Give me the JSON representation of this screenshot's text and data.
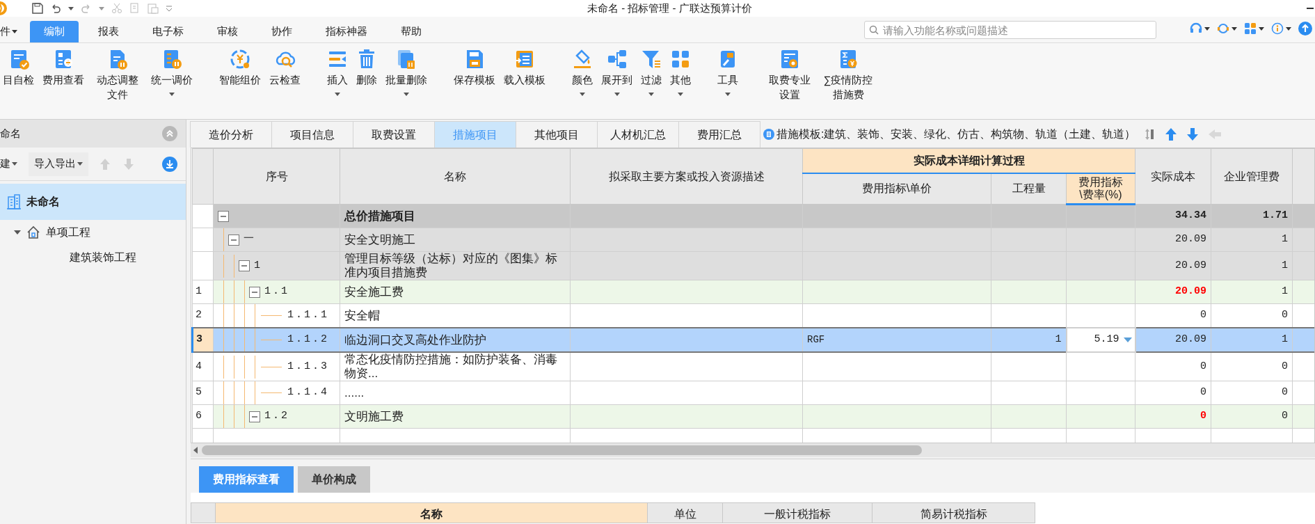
{
  "title_bar": {
    "title": "未命名 - 招标管理 - 广联达预算计价"
  },
  "menu": [
    {
      "label": "件",
      "selected": false
    },
    {
      "label": "编制",
      "selected": true
    },
    {
      "label": "报表",
      "selected": false
    },
    {
      "label": "电子标",
      "selected": false
    },
    {
      "label": "审核",
      "selected": false
    },
    {
      "label": "协作",
      "selected": false
    },
    {
      "label": "指标神器",
      "selected": false
    },
    {
      "label": "帮助",
      "selected": false
    }
  ],
  "search": {
    "placeholder": "请输入功能名称或问题描述"
  },
  "ribbon": {
    "groups": [
      [
        {
          "label": "目自检",
          "dropdown": false
        },
        {
          "label": "费用查看",
          "dropdown": false
        },
        {
          "label": "动态调整文件",
          "dropdown": false
        },
        {
          "label": "统一调价",
          "dropdown": true
        }
      ],
      [
        {
          "label": "智能组价",
          "dropdown": false
        },
        {
          "label": "云检查",
          "dropdown": false
        }
      ],
      [
        {
          "label": "插入",
          "dropdown": true
        },
        {
          "label": "删除",
          "dropdown": false
        },
        {
          "label": "批量删除",
          "dropdown": true
        }
      ],
      [
        {
          "label": "保存模板",
          "dropdown": false
        },
        {
          "label": "载入模板",
          "dropdown": false
        }
      ],
      [
        {
          "label": "颜色",
          "dropdown": true
        },
        {
          "label": "展开到",
          "dropdown": true
        },
        {
          "label": "过滤",
          "dropdown": true
        },
        {
          "label": "其他",
          "dropdown": true
        }
      ],
      [
        {
          "label": "工具",
          "dropdown": true
        }
      ],
      [
        {
          "label": "取费专业设置",
          "dropdown": false
        },
        {
          "label": "∑疫情防控措施费",
          "dropdown": false
        }
      ]
    ]
  },
  "left_panel": {
    "title": "命名",
    "toolbar": [
      {
        "label": "建",
        "dropdown": true
      },
      {
        "label": "导入导出",
        "dropdown": true
      }
    ],
    "tree": [
      {
        "label": "未命名",
        "selected": true,
        "children": [
          {
            "label": "单项工程",
            "selected": false,
            "expanded": true,
            "children": [
              {
                "label": "建筑装饰工程",
                "selected": false
              }
            ]
          }
        ]
      }
    ]
  },
  "doc_tabs": [
    {
      "label": "造价分析",
      "selected": false
    },
    {
      "label": "项目信息",
      "selected": false
    },
    {
      "label": "取费设置",
      "selected": false
    },
    {
      "label": "措施项目",
      "selected": true
    },
    {
      "label": "其他项目",
      "selected": false
    },
    {
      "label": "人材机汇总",
      "selected": false
    },
    {
      "label": "费用汇总",
      "selected": false
    }
  ],
  "template_note": "措施模板:建筑、装饰、安装、绿化、仿古、构筑物、轨道（土建、轨道）",
  "table": {
    "group_header": "实际成本详细计算过程",
    "columns": [
      {
        "label": "序号",
        "grouped": false,
        "selected": false
      },
      {
        "label": "名称",
        "grouped": false,
        "selected": false
      },
      {
        "label": "拟采取主要方案或投入资源描述",
        "grouped": false,
        "selected": false
      },
      {
        "label": "费用指标\\单价",
        "grouped": true,
        "selected": false
      },
      {
        "label": "工程量",
        "grouped": true,
        "selected": false
      },
      {
        "label": "费用指标\n\\费率(%)",
        "grouped": true,
        "selected": true
      },
      {
        "label": "实际成本",
        "grouped": false,
        "selected": false
      },
      {
        "label": "企业管理费",
        "grouped": false,
        "selected": false
      }
    ],
    "rows": [
      {
        "kind": "total",
        "name": "总价措施项目",
        "cost": "34.34",
        "fee": "1.71",
        "expanded": true,
        "selected": false,
        "children": [
          {
            "kind": "group",
            "code": "一",
            "name": "安全文明施工",
            "cost": "20.09",
            "fee": "1",
            "expanded": true,
            "selected": false,
            "children": [
              {
                "kind": "group",
                "code": "1",
                "name": "管理目标等级（达标）对应的《图集》标准内项目措施费",
                "cost": "20.09",
                "fee": "1",
                "expanded": true,
                "selected": false,
                "children": [
                  {
                    "kind": "subtotal",
                    "no": "1",
                    "code": "1.1",
                    "name": "安全施工费",
                    "cost": "20.09",
                    "fee": "1",
                    "expanded": true,
                    "selected": false,
                    "children": [
                      {
                        "kind": "item",
                        "no": "2",
                        "code": "1.1.1",
                        "name": "安全帽",
                        "cost": "0",
                        "fee": "0",
                        "selected": false
                      },
                      {
                        "kind": "item",
                        "no": "3",
                        "code": "1.1.2",
                        "name": "临边洞口交叉高处作业防护",
                        "unit_price": "RGF",
                        "quantity": "1",
                        "rate": "5.19",
                        "cost": "20.09",
                        "fee": "1",
                        "selected": true
                      },
                      {
                        "kind": "item",
                        "no": "4",
                        "code": "1.1.3",
                        "name": "常态化疫情防控措施：如防护装备、消毒物资...",
                        "cost": "0",
                        "fee": "0",
                        "selected": false
                      },
                      {
                        "kind": "item",
                        "no": "5",
                        "code": "1.1.4",
                        "name": "......",
                        "cost": "0",
                        "fee": "0",
                        "selected": false
                      }
                    ]
                  },
                  {
                    "kind": "subtotal",
                    "no": "6",
                    "code": "1.2",
                    "name": "文明施工费",
                    "cost": "0",
                    "fee": "0",
                    "expanded": true,
                    "selected": false
                  }
                ]
              }
            ]
          }
        ]
      }
    ]
  },
  "bottom_tabs": [
    {
      "label": "费用指标查看",
      "selected": true
    },
    {
      "label": "单价构成",
      "selected": false
    }
  ],
  "bottom_table": {
    "columns": [
      "名称",
      "单位",
      "一般计税指标",
      "简易计税指标"
    ]
  }
}
